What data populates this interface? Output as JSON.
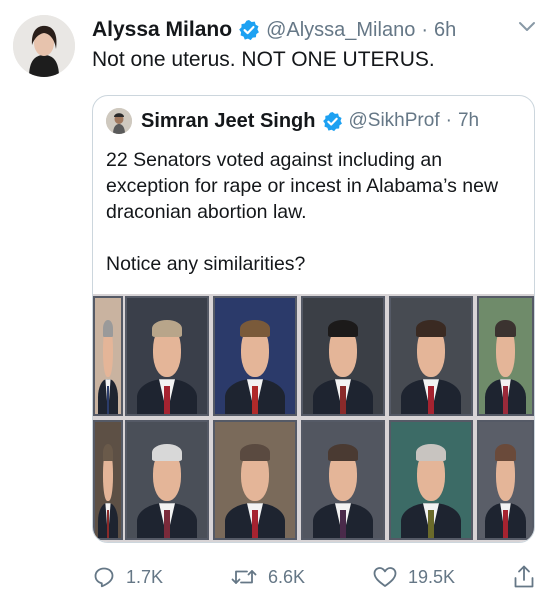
{
  "tweet": {
    "author_name": "Alyssa Milano",
    "author_handle": "@Alyssa_Milano",
    "separator": "·",
    "time": "6h",
    "text": "Not one uterus. NOT ONE UTERUS."
  },
  "quoted_tweet": {
    "author_name": "Simran Jeet Singh",
    "author_handle": "@SikhProf",
    "separator": "·",
    "time": "7h",
    "text_paragraph_1": "22 Senators voted against including an exception for rape or incest in Alabama’s new draconian abortion law.",
    "text_paragraph_2": "Notice any similarities?"
  },
  "photos": [
    {
      "name": "senator-photo-1",
      "bg": "#c9b3a0",
      "hair": "#9a9a9a",
      "tie": "#2b3c6a"
    },
    {
      "name": "senator-photo-2",
      "bg": "#3a3f4a",
      "hair": "#b8a58a",
      "tie": "#a52330"
    },
    {
      "name": "senator-photo-3",
      "bg": "#2b3a6a",
      "hair": "#7a5a3a",
      "tie": "#b02a2a"
    },
    {
      "name": "senator-photo-4",
      "bg": "#3b3f46",
      "hair": "#1c1a1a",
      "tie": "#8a2a2a"
    },
    {
      "name": "senator-photo-5",
      "bg": "#474b52",
      "hair": "#3a2a22",
      "tie": "#a52330"
    },
    {
      "name": "senator-photo-6",
      "bg": "#6f8b6a",
      "hair": "#3b3330",
      "tie": "#9a2a3a"
    },
    {
      "name": "senator-photo-7",
      "bg": "#5d5045",
      "hair": "#6a5a4a",
      "tie": "#8a2a2a"
    },
    {
      "name": "senator-photo-8",
      "bg": "#4a4f58",
      "hair": "#d8d8d8",
      "tie": "#7a2a3a"
    },
    {
      "name": "senator-photo-9",
      "bg": "#7a6a5a",
      "hair": "#5a4a40",
      "tie": "#a52330"
    },
    {
      "name": "senator-photo-10",
      "bg": "#525660",
      "hair": "#4a3a32",
      "tie": "#4a2a4a"
    },
    {
      "name": "senator-photo-11",
      "bg": "#3c6b66",
      "hair": "#c8c4c0",
      "tie": "#6a6a2a"
    },
    {
      "name": "senator-photo-12",
      "bg": "#5a5e68",
      "hair": "#6a4a3a",
      "tie": "#a52330"
    }
  ],
  "actions": {
    "reply_count": "1.7K",
    "retweet_count": "6.6K",
    "like_count": "19.5K"
  },
  "colors": {
    "verified_blue": "#1da1f2",
    "secondary_text": "#657786",
    "border": "#ccd6dd"
  },
  "icons": [
    "verified-badge-icon",
    "chevron-down-icon",
    "reply-icon",
    "retweet-icon",
    "like-icon",
    "share-icon"
  ]
}
